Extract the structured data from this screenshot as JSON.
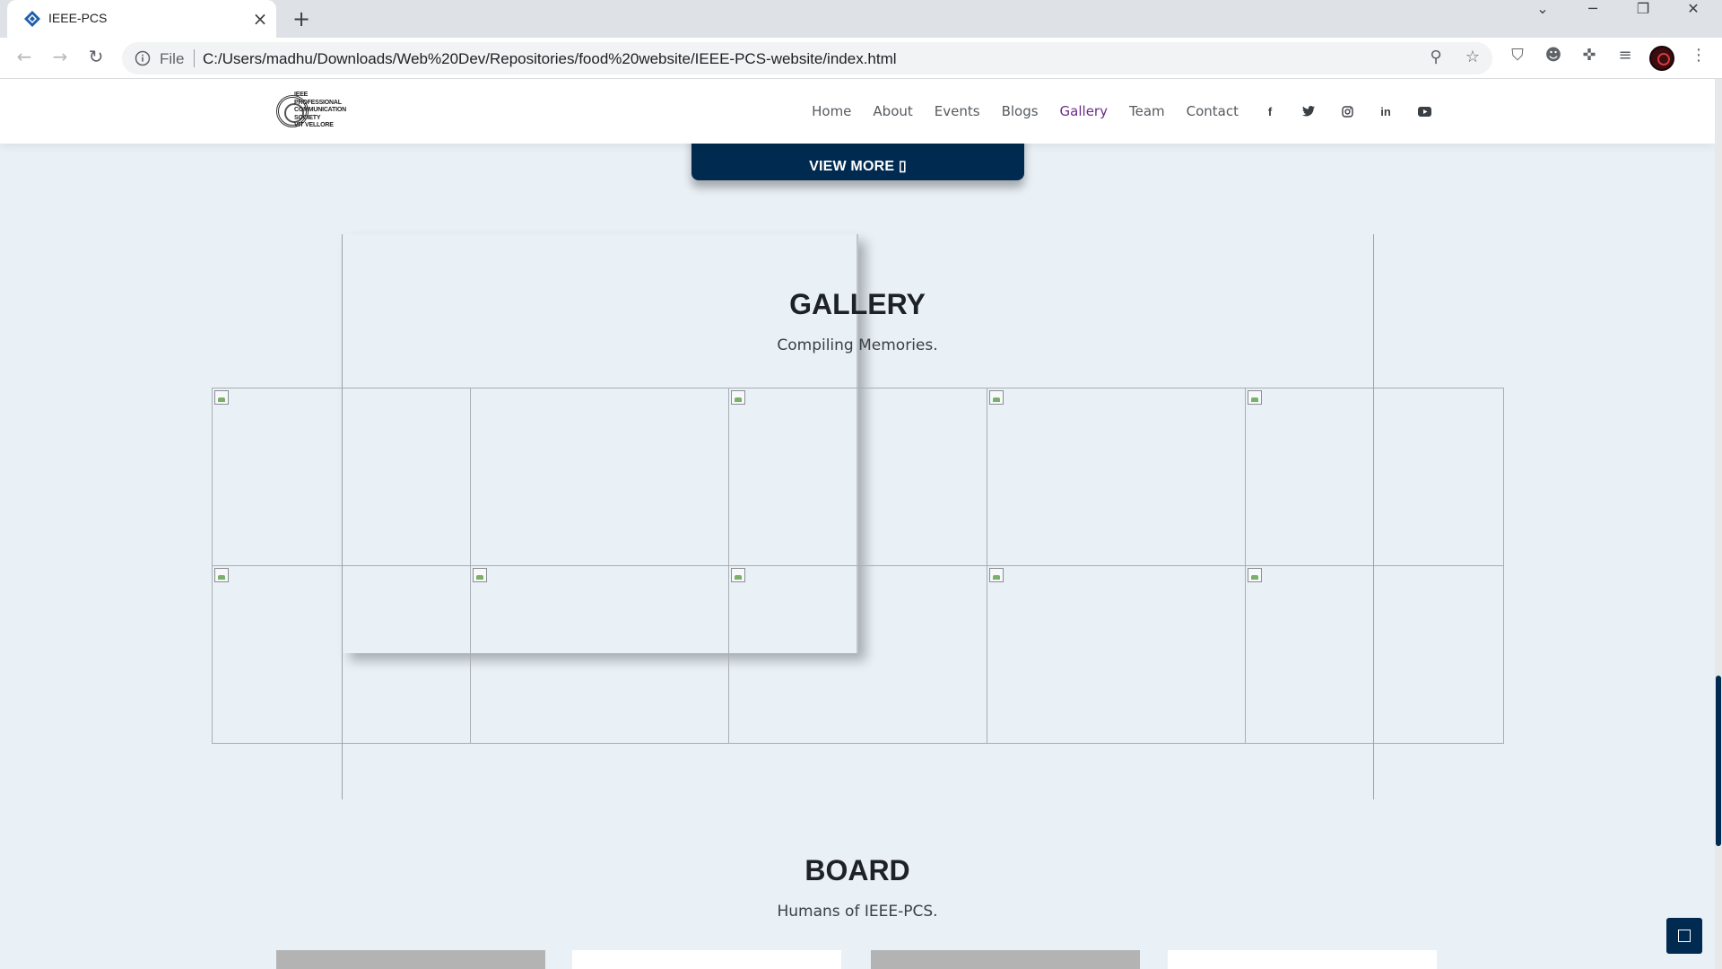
{
  "browser": {
    "tab_title": "IEEE-PCS",
    "omnibox": {
      "scheme_label": "File",
      "url": "C:/Users/madhu/Downloads/Web%20Dev/Repositories/food%20website/IEEE-PCS-website/index.html"
    }
  },
  "site": {
    "logo": {
      "lines": [
        "IEEE",
        "PROFESSIONAL",
        "COMMUNICATION",
        "SOCIETY",
        "VIT VELLORE"
      ]
    },
    "nav": {
      "links": [
        "Home",
        "About",
        "Events",
        "Blogs",
        "Gallery",
        "Team",
        "Contact"
      ],
      "active": "Gallery",
      "social_icons": [
        "facebook-icon",
        "twitter-icon",
        "instagram-icon",
        "linkedin-icon",
        "youtube-icon"
      ]
    }
  },
  "view_more": {
    "label": "VIEW MORE ▯"
  },
  "gallery": {
    "title": "GALLERY",
    "subtitle": "Compiling Memories.",
    "images_total": 10,
    "broken_image_flags": [
      true,
      false,
      true,
      true,
      true,
      true,
      true,
      true,
      true,
      true
    ]
  },
  "board": {
    "title": "BOARD",
    "subtitle": "Humans of IEEE-PCS.",
    "card_fills": [
      "#b3b3b3",
      "#ffffff",
      "#b3b3b3",
      "#ffffff"
    ]
  },
  "colors": {
    "accent_navy": "#002a50",
    "active_link": "#6a2c86",
    "page_background": "#e9f0f6"
  }
}
